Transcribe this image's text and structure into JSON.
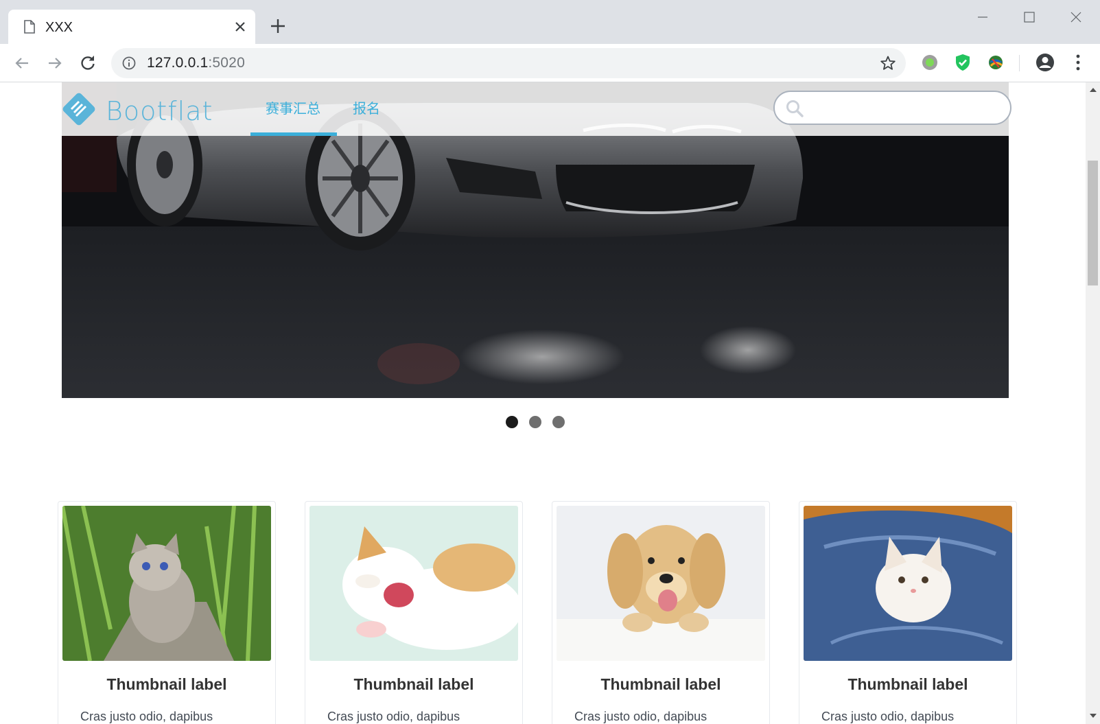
{
  "browser": {
    "tab_title": "XXX",
    "url_host": "127.0.0.1",
    "url_port": ":5020"
  },
  "navbar": {
    "brand": "Bootflat",
    "items": [
      {
        "label": "赛事汇总",
        "active": true
      },
      {
        "label": "报名",
        "active": false
      }
    ],
    "search_placeholder": ""
  },
  "carousel": {
    "slide_count": 3,
    "active_index": 0
  },
  "thumbnails": [
    {
      "label": "Thumbnail label",
      "text": "Cras justo odio, dapibus"
    },
    {
      "label": "Thumbnail label",
      "text": "Cras justo odio, dapibus"
    },
    {
      "label": "Thumbnail label",
      "text": "Cras justo odio, dapibus"
    },
    {
      "label": "Thumbnail label",
      "text": "Cras justo odio, dapibus"
    }
  ],
  "colors": {
    "accent": "#3bafda",
    "brand": "#5ab4d9"
  }
}
